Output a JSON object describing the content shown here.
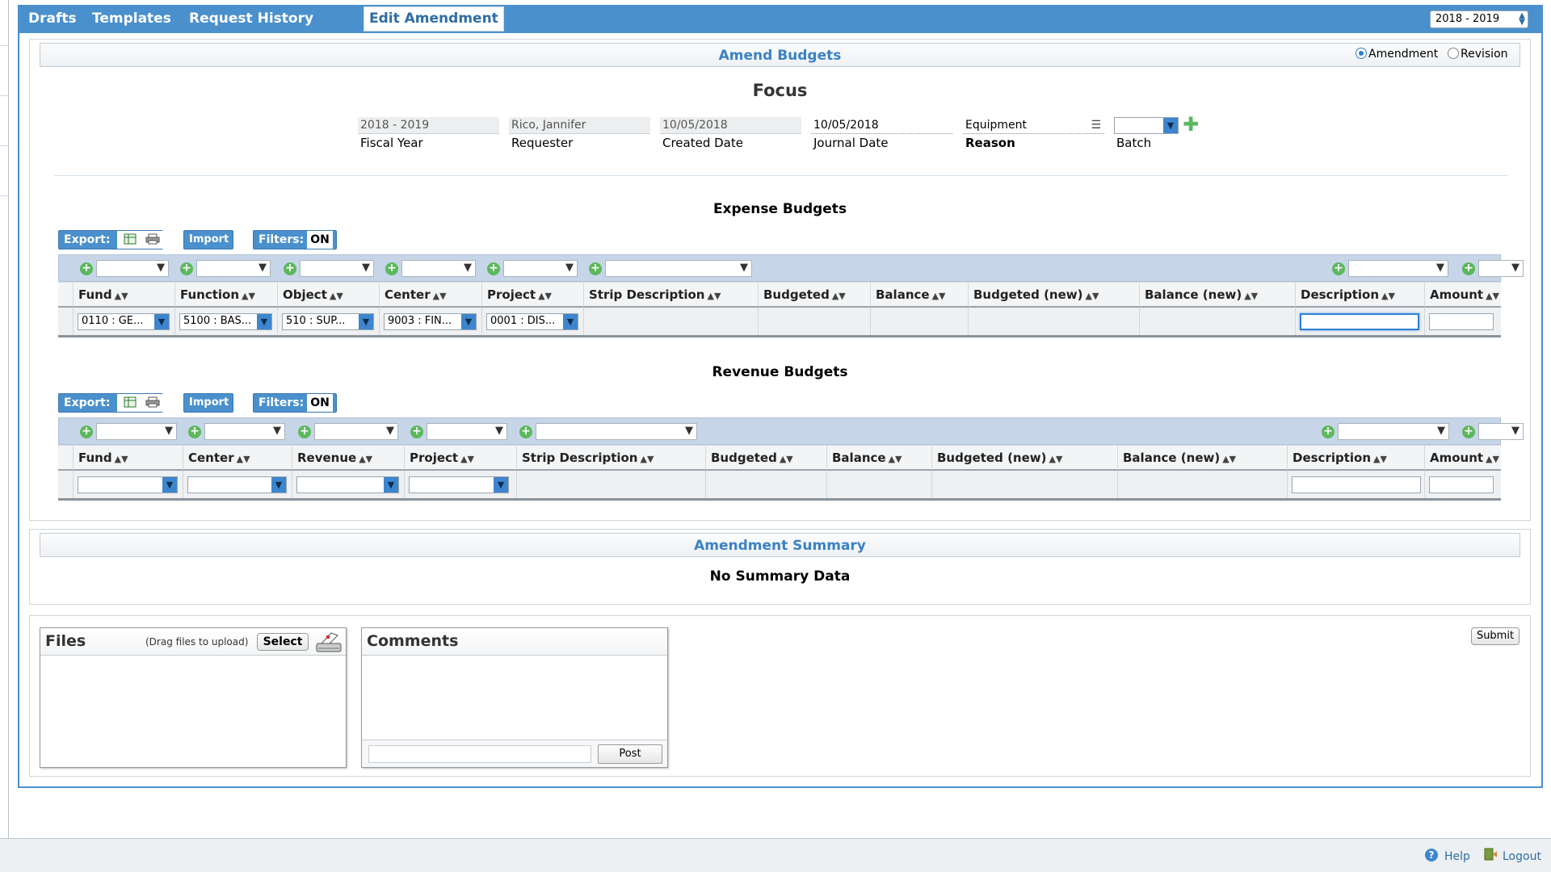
{
  "nav": {
    "tabs": [
      {
        "label": "Drafts"
      },
      {
        "label": "Templates"
      },
      {
        "label": "Request History"
      },
      {
        "label": "Edit Amendment"
      }
    ],
    "year_select": "2018 - 2019"
  },
  "amend": {
    "title": "Amend Budgets",
    "radio_amendment": "Amendment",
    "radio_revision": "Revision",
    "selected_mode": "Amendment",
    "focus_title": "Focus",
    "fields": {
      "fiscal_year": {
        "value": "2018 - 2019",
        "label": "Fiscal Year"
      },
      "requester": {
        "value": "Rico, Jannifer",
        "label": "Requester"
      },
      "created_date": {
        "value": "10/05/2018",
        "label": "Created Date"
      },
      "journal_date": {
        "value": "10/05/2018",
        "label": "Journal Date"
      },
      "reason": {
        "value": "Equipment",
        "label": "Reason"
      },
      "batch": {
        "value": "",
        "label": "Batch"
      }
    }
  },
  "toolbar": {
    "export_label": "Export:",
    "import_label": "Import",
    "filters_label": "Filters:",
    "filters_state": "ON"
  },
  "expense": {
    "title": "Expense Budgets",
    "columns": [
      "Fund",
      "Function",
      "Object",
      "Center",
      "Project",
      "Strip Description",
      "Budgeted",
      "Balance",
      "Budgeted (new)",
      "Balance (new)",
      "Description",
      "Amount"
    ],
    "row": {
      "fund": "0110 : GE...",
      "function": "5100 : BAS...",
      "object": "510 : SUP...",
      "center": "9003 : FIN...",
      "project": "0001 : DIS..."
    }
  },
  "revenue": {
    "title": "Revenue Budgets",
    "columns": [
      "Fund",
      "Center",
      "Revenue",
      "Project",
      "Strip Description",
      "Budgeted",
      "Balance",
      "Budgeted (new)",
      "Balance (new)",
      "Description",
      "Amount"
    ]
  },
  "summary": {
    "title": "Amendment Summary",
    "empty_text": "No Summary Data"
  },
  "files": {
    "title": "Files",
    "hint": "(Drag files to upload)",
    "select_label": "Select"
  },
  "comments": {
    "title": "Comments",
    "post_label": "Post",
    "input_value": ""
  },
  "submit_label": "Submit",
  "footer": {
    "help": "Help",
    "logout": "Logout"
  },
  "colors": {
    "brand_blue": "#4a90cc",
    "header_text": "#3a82c4",
    "filter_bar": "#c6d6e8",
    "add_green": "#5cb85c"
  }
}
